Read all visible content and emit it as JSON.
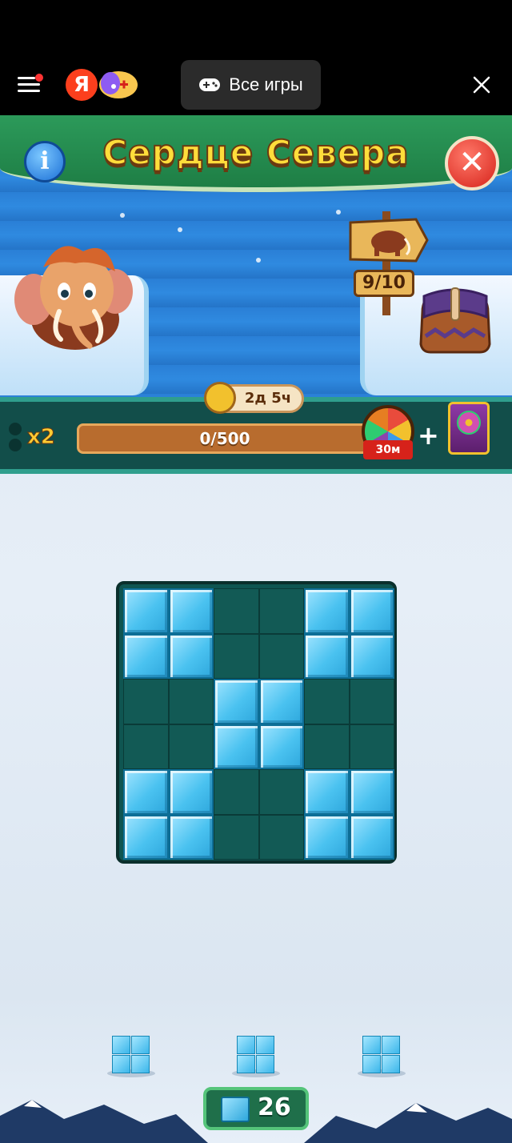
{
  "topbar": {
    "all_games_label": "Все игры",
    "yandex_letter": "Я"
  },
  "game": {
    "title": "Сердце Севера",
    "info_label": "i",
    "close_label": "✕",
    "sign_count": "9/10",
    "timer": "2д 5ч",
    "multiplier": "x2",
    "progress": {
      "text": "0/500",
      "current": 0,
      "max": 500
    },
    "wheel_label": "30м",
    "plus": "+",
    "board": [
      [
        1,
        1,
        0,
        0,
        1,
        1
      ],
      [
        1,
        1,
        0,
        0,
        1,
        1
      ],
      [
        0,
        0,
        1,
        1,
        0,
        0
      ],
      [
        0,
        0,
        1,
        1,
        0,
        0
      ],
      [
        1,
        1,
        0,
        0,
        1,
        1
      ],
      [
        1,
        1,
        0,
        0,
        1,
        1
      ]
    ],
    "pieces": [
      "2x2 ice block",
      "2x2 ice block",
      "2x2 ice block"
    ],
    "counter": "26"
  }
}
